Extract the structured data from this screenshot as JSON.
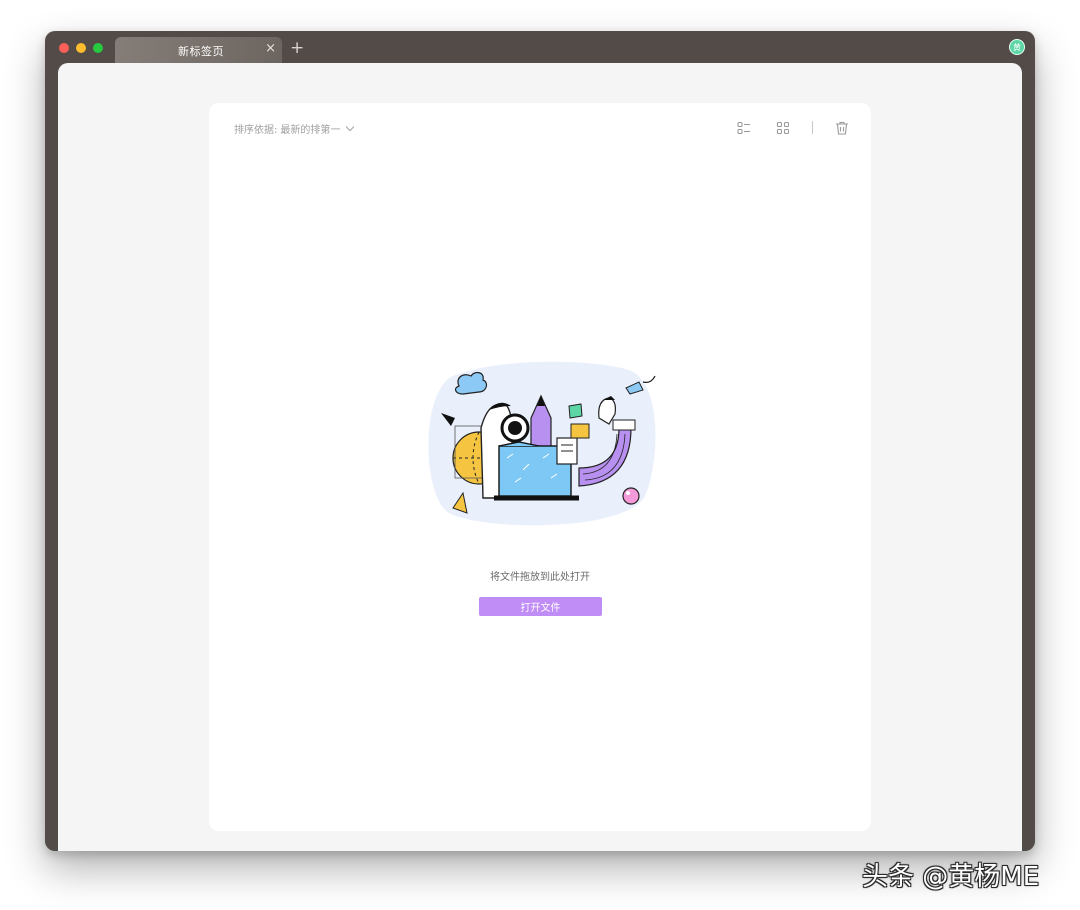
{
  "tabs": [
    {
      "title": "新标签页",
      "close": "×"
    }
  ],
  "new_tab": "+",
  "avatar": {
    "initial": "黄",
    "color": "#5cd6a5"
  },
  "toolbar": {
    "sort_label": "排序依据:",
    "sort_value": "最新的排第一",
    "icons": [
      "list-view-icon",
      "grid-view-icon",
      "trash-icon"
    ]
  },
  "empty_state": {
    "message": "将文件拖放到此处打开",
    "button_label": "打开文件"
  },
  "colors": {
    "accent": "#c08cf5",
    "titlebar": "#524b47",
    "content_bg": "#f5f5f5"
  },
  "watermark": "头条 @黄杨ME"
}
